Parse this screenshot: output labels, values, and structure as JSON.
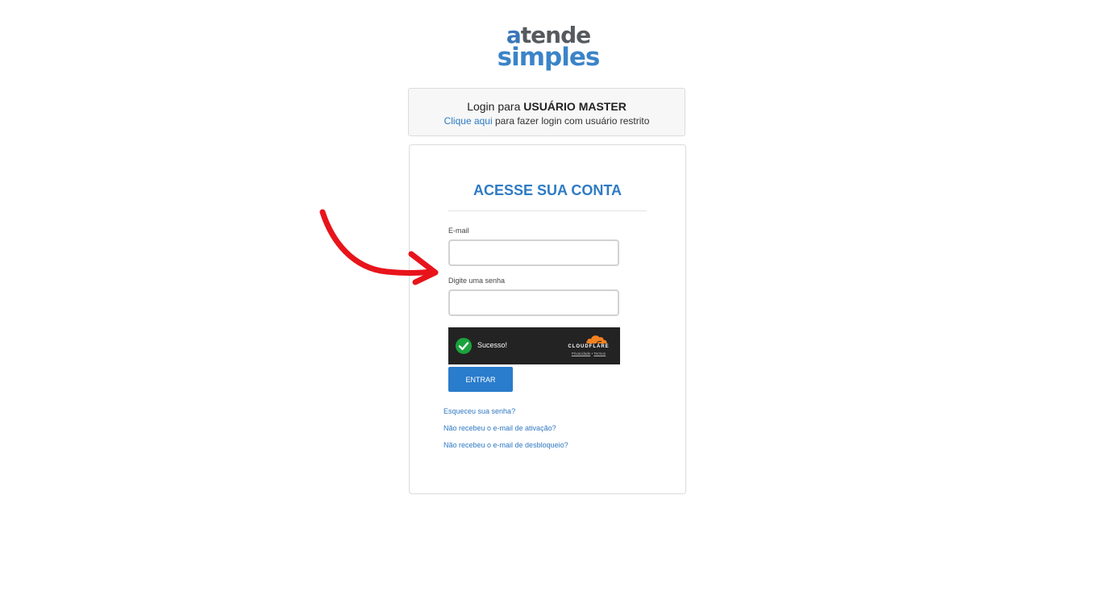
{
  "logo": {
    "line1_accent": "a",
    "line1_rest": "tende",
    "line2": "simples"
  },
  "header": {
    "title_prefix": "Login para ",
    "title_bold": "USUÁRIO MASTER",
    "link_text": "Clique aqui",
    "sub_rest": " para fazer login com usuário restrito"
  },
  "card": {
    "title": "ACESSE SUA CONTA",
    "email_label": "E-mail",
    "email_value": "",
    "password_label": "Digite uma senha",
    "password_value": "",
    "submit_label": "ENTRAR"
  },
  "captcha": {
    "status": "Sucesso!",
    "brand": "CLOUDFLARE",
    "privacy": "Privacidade",
    "separator": " • ",
    "terms": "Termos"
  },
  "links": {
    "forgot_password": "Esqueceu sua senha?",
    "no_activation": "Não recebeu o e-mail de ativação?",
    "no_unlock": "Não recebeu o e-mail de desbloqueio?"
  },
  "colors": {
    "primary": "#2a7ccc",
    "title": "#2e7bc4",
    "arrow": "#e8141b",
    "success": "#1aa33c",
    "cloudflare_orange": "#f48120"
  },
  "icons": {
    "check": "check-icon",
    "cloud": "cloudflare-cloud-icon",
    "arrow": "red-arrow-annotation"
  }
}
